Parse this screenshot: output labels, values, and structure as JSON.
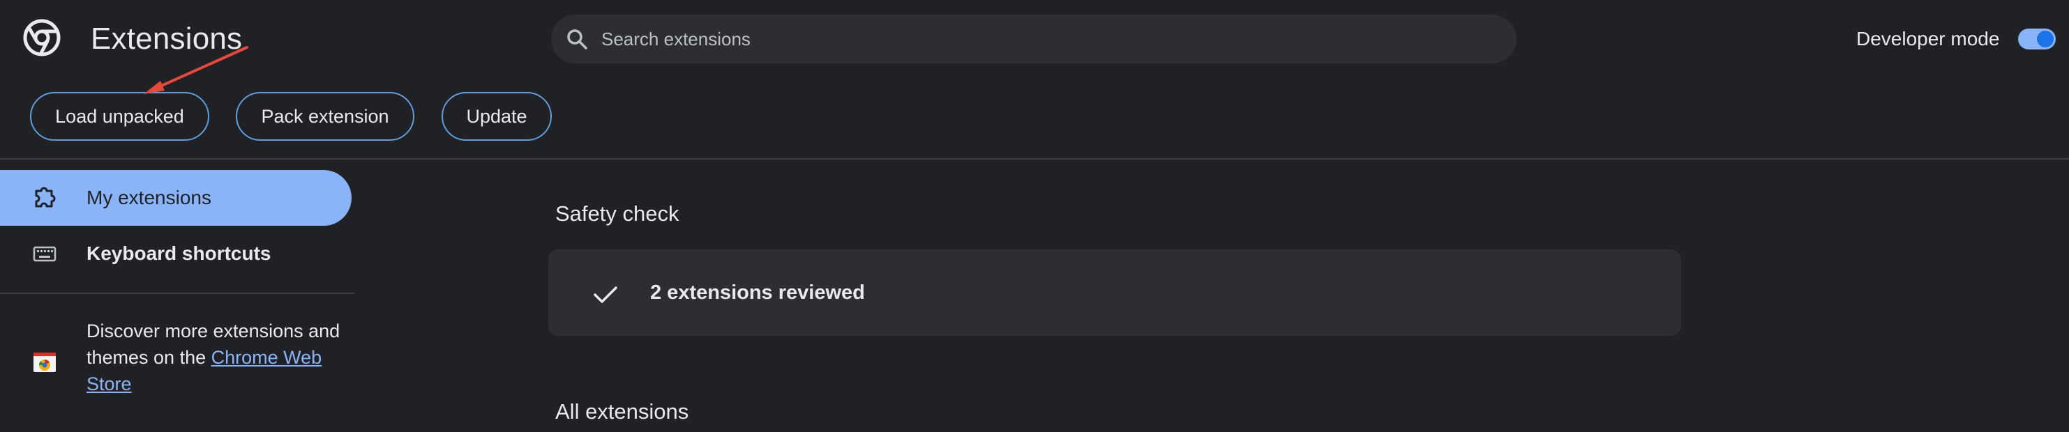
{
  "header": {
    "title": "Extensions",
    "logo_icon": "chrome-logo-icon",
    "search": {
      "placeholder": "Search extensions",
      "value": "",
      "icon": "search-icon"
    },
    "developer_mode": {
      "label": "Developer mode",
      "enabled": true
    }
  },
  "toolbar": {
    "load_unpacked": "Load unpacked",
    "pack_extension": "Pack extension",
    "update": "Update"
  },
  "sidebar": {
    "items": [
      {
        "label": "My extensions",
        "icon": "extension-puzzle-icon",
        "active": true
      },
      {
        "label": "Keyboard shortcuts",
        "icon": "keyboard-icon",
        "active": false
      }
    ],
    "store_promo": {
      "text": "Discover more extensions and themes on the ",
      "link": "Chrome Web Store",
      "icon": "chrome-web-store-icon"
    }
  },
  "main": {
    "safety_check": {
      "title": "Safety check",
      "status": "2 extensions reviewed",
      "icon": "checkmark-icon"
    },
    "all_extensions_title": "All extensions"
  },
  "colors": {
    "background": "#202124",
    "surface": "#2d2e31",
    "accent": "#8ab4f8",
    "button_border": "#5f9ede",
    "annotation_arrow": "#e8483a"
  }
}
